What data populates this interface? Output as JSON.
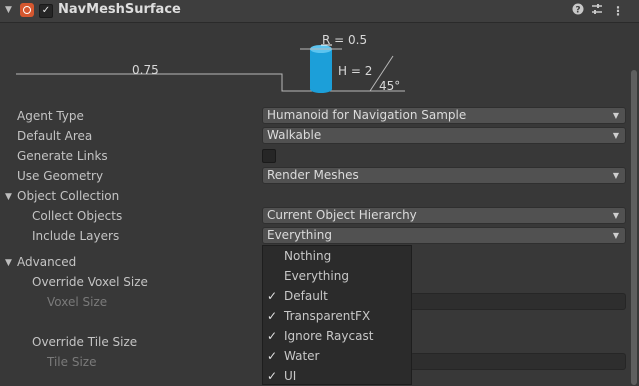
{
  "header": {
    "title": "NavMeshSurface",
    "enabled": "✓"
  },
  "diagram": {
    "radius_label": "R = 0.5",
    "height_label": "H = 2",
    "step_label": "0.75",
    "slope_label": "45°"
  },
  "properties": {
    "agent_type": {
      "label": "Agent Type",
      "value": "Humanoid for Navigation Sample"
    },
    "default_area": {
      "label": "Default Area",
      "value": "Walkable"
    },
    "generate_links": {
      "label": "Generate Links"
    },
    "use_geometry": {
      "label": "Use Geometry",
      "value": "Render Meshes"
    }
  },
  "object_collection": {
    "label": "Object Collection",
    "collect_objects": {
      "label": "Collect Objects",
      "value": "Current Object Hierarchy"
    },
    "include_layers": {
      "label": "Include Layers",
      "value": "Everything"
    }
  },
  "advanced": {
    "label": "Advanced",
    "override_voxel_size": "Override Voxel Size",
    "voxel_size": "Voxel Size",
    "override_tile_size": "Override Tile Size",
    "tile_size": "Tile Size"
  },
  "layers_menu": {
    "items": [
      {
        "label": "Nothing",
        "check": ""
      },
      {
        "label": "Everything",
        "check": ""
      },
      {
        "label": "Default",
        "check": "✓"
      },
      {
        "label": "TransparentFX",
        "check": "✓"
      },
      {
        "label": "Ignore Raycast",
        "check": "✓"
      },
      {
        "label": "Water",
        "check": "✓"
      },
      {
        "label": "UI",
        "check": "✓"
      }
    ]
  },
  "colors": {
    "accent": "#1c9fd9",
    "background": "#383838"
  }
}
